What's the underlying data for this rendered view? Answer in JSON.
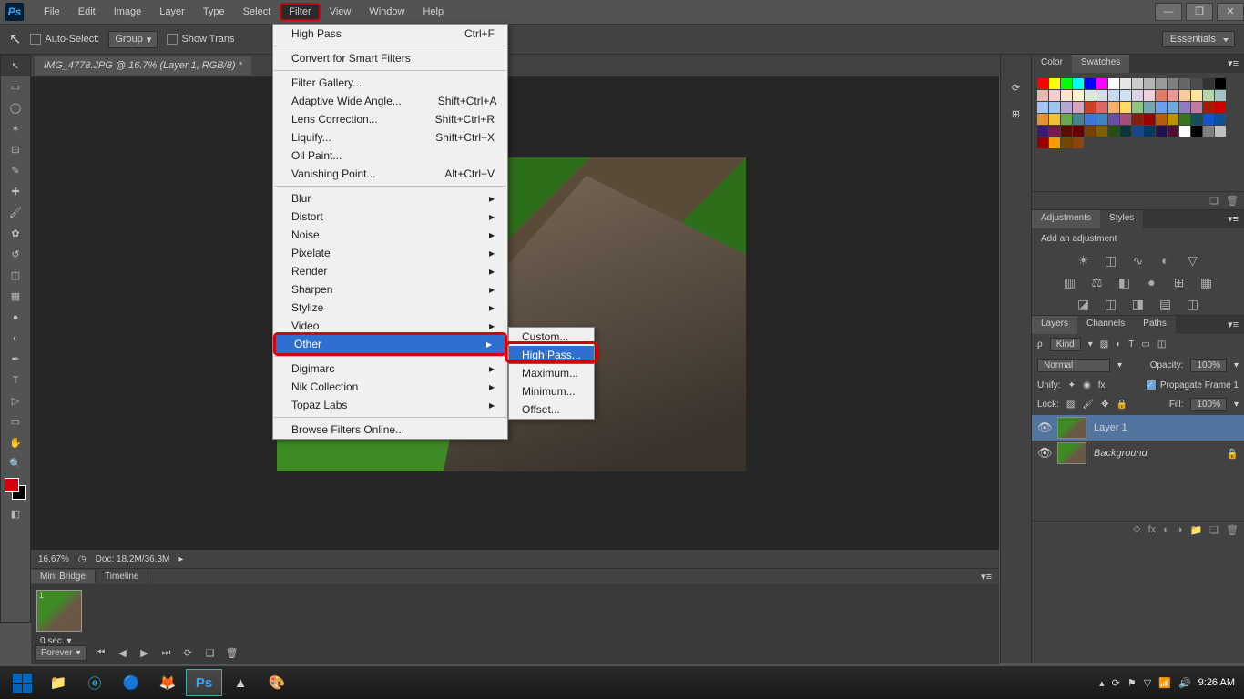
{
  "app": {
    "name": "Ps"
  },
  "menu": {
    "file": "File",
    "edit": "Edit",
    "image": "Image",
    "layer": "Layer",
    "type": "Type",
    "select": "Select",
    "filter": "Filter",
    "view": "View",
    "window": "Window",
    "help": "Help"
  },
  "options": {
    "auto_select": "Auto-Select:",
    "group": "Group",
    "show_trans": "Show Trans",
    "workspace": "Essentials"
  },
  "doc_tab": "IMG_4778.JPG @ 16.7% (Layer 1, RGB/8) *",
  "status": {
    "zoom": "16.67%",
    "doc": "Doc:  18.2M/36.3M"
  },
  "bottom_tabs": {
    "mini": "Mini Bridge",
    "timeline": "Timeline"
  },
  "timeline": {
    "frame_num": "1",
    "frame_time": "0 sec.",
    "loop": "Forever"
  },
  "filter_menu": {
    "last": "High Pass",
    "last_sc": "Ctrl+F",
    "convert": "Convert for Smart Filters",
    "gallery": "Filter Gallery...",
    "adaptive": "Adaptive Wide Angle...",
    "adaptive_sc": "Shift+Ctrl+A",
    "lens": "Lens Correction...",
    "lens_sc": "Shift+Ctrl+R",
    "liquify": "Liquify...",
    "liquify_sc": "Shift+Ctrl+X",
    "oil": "Oil Paint...",
    "vanish": "Vanishing Point...",
    "vanish_sc": "Alt+Ctrl+V",
    "blur": "Blur",
    "distort": "Distort",
    "noise": "Noise",
    "pixelate": "Pixelate",
    "render": "Render",
    "sharpen": "Sharpen",
    "stylize": "Stylize",
    "video": "Video",
    "other": "Other",
    "digimarc": "Digimarc",
    "nik": "Nik Collection",
    "topaz": "Topaz Labs",
    "browse": "Browse Filters Online..."
  },
  "other_submenu": {
    "custom": "Custom...",
    "highpass": "High Pass...",
    "maximum": "Maximum...",
    "minimum": "Minimum...",
    "offset": "Offset..."
  },
  "panels": {
    "color": "Color",
    "swatches": "Swatches",
    "adjustments": "Adjustments",
    "styles": "Styles",
    "add_adj": "Add an adjustment",
    "layers": "Layers",
    "channels": "Channels",
    "paths": "Paths",
    "kind": "Kind",
    "normal": "Normal",
    "opacity_label": "Opacity:",
    "opacity": "100%",
    "unify": "Unify:",
    "propagate": "Propagate Frame 1",
    "lock": "Lock:",
    "fill_label": "Fill:",
    "fill": "100%",
    "layer1": "Layer 1",
    "background": "Background"
  },
  "taskbar": {
    "time": "9:26 AM"
  },
  "swatch_colors": [
    "#ff0000",
    "#ffff00",
    "#00ff00",
    "#00ffff",
    "#0000ff",
    "#ff00ff",
    "#ffffff",
    "#e6e6e6",
    "#cccccc",
    "#b3b3b3",
    "#999999",
    "#808080",
    "#666666",
    "#4d4d4d",
    "#333333",
    "#000000",
    "#e6b8af",
    "#f4cccc",
    "#fce5cd",
    "#fff2cc",
    "#d9ead3",
    "#d0e0e3",
    "#c9daf8",
    "#cfe2f3",
    "#d9d2e9",
    "#ead1dc",
    "#dd7e6b",
    "#ea9999",
    "#f9cb9c",
    "#ffe599",
    "#b6d7a8",
    "#a2c4c9",
    "#a4c2f4",
    "#9fc5e8",
    "#b4a7d6",
    "#d5a6bd",
    "#cc4125",
    "#e06666",
    "#f6b26b",
    "#ffd966",
    "#93c47d",
    "#76a5af",
    "#6d9eeb",
    "#6fa8dc",
    "#8e7cc3",
    "#c27ba0",
    "#a61c00",
    "#cc0000",
    "#e69138",
    "#f1c232",
    "#6aa84f",
    "#45818e",
    "#3c78d8",
    "#3d85c6",
    "#674ea7",
    "#a64d79",
    "#85200c",
    "#990000",
    "#b45f06",
    "#bf9000",
    "#38761d",
    "#134f5c",
    "#1155cc",
    "#0b5394",
    "#351c75",
    "#741b47",
    "#5b0f00",
    "#660000",
    "#783f04",
    "#7f6000",
    "#274e13",
    "#0c343d",
    "#1c4587",
    "#073763",
    "#20124d",
    "#4c1130",
    "#ffffff",
    "#000000",
    "#7f7f7f",
    "#c0c0c0",
    "#980000",
    "#ff9900",
    "#744700",
    "#8b4513"
  ]
}
